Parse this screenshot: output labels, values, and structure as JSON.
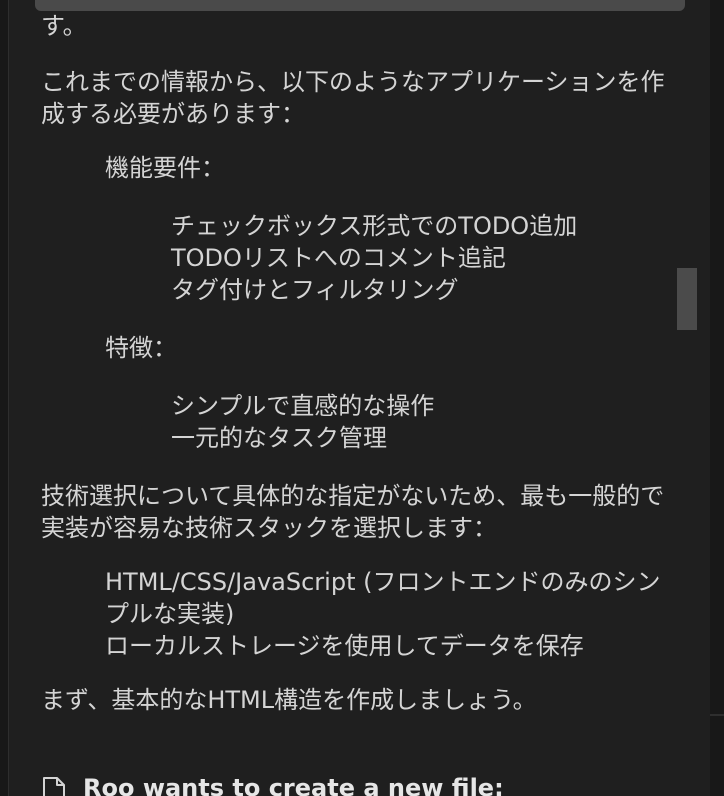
{
  "message": {
    "previous_tail": "す。",
    "intro": "これまでの情報から、以下のようなアプリケーションを作成する必要があります：",
    "functional": {
      "heading": "機能要件：",
      "items": [
        "チェックボックス形式でのTODO追加",
        "TODOリストへのコメント追記",
        "タグ付けとフィルタリング"
      ]
    },
    "features": {
      "heading": "特徴：",
      "items": [
        "シンプルで直感的な操作",
        "一元的なタスク管理"
      ]
    },
    "tech_intro": "技術選択について具体的な指定がないため、最も一般的で実装が容易な技術スタックを選択します：",
    "tech_items": [
      "HTML/CSS/JavaScript (フロントエンドのみのシンプルな実装)",
      "ローカルストレージを使用してデータを保存"
    ],
    "closing": "まず、基本的なHTML構造を作成しましょう。"
  },
  "tool_call": {
    "icon": "file-icon",
    "label": "Roo wants to create a new file:"
  }
}
